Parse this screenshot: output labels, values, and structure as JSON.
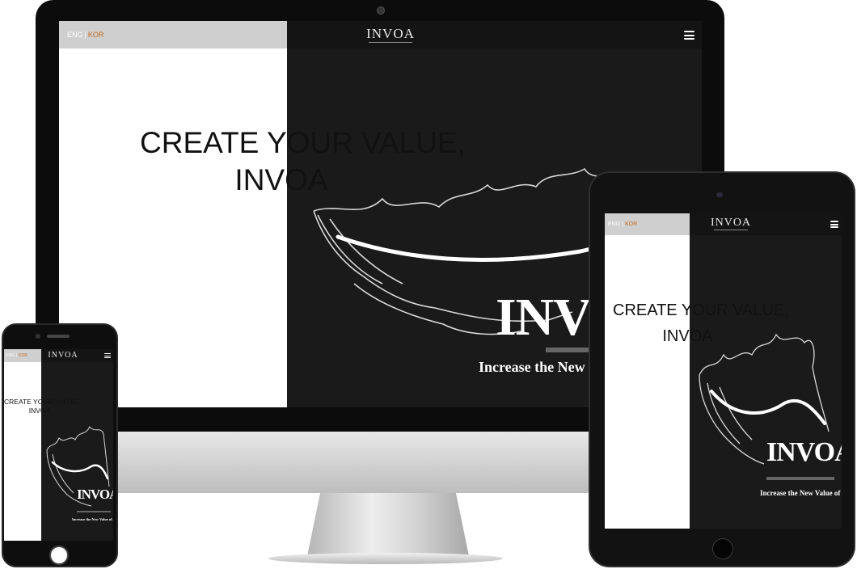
{
  "site": {
    "lang_eng": "ENG",
    "lang_separator": "|",
    "lang_kor": "KOR",
    "logo": "INVOA",
    "headline_line1": "CREATE YOUR VALUE,",
    "headline_line2": "INVOA",
    "brand_big": "INVOA",
    "tagline": "Increase the New Value of Artist",
    "menu_icon": "hamburger-icon"
  },
  "monitor_visible": {
    "brand_big": "INV",
    "tagline": "Increase the New V"
  },
  "colors": {
    "site_dark": "#1a1a1a",
    "site_light": "#ffffff",
    "lang_box": "#cfcfcf",
    "lang_active": "#c46a1f",
    "text_on_dark": "#ffffff"
  }
}
